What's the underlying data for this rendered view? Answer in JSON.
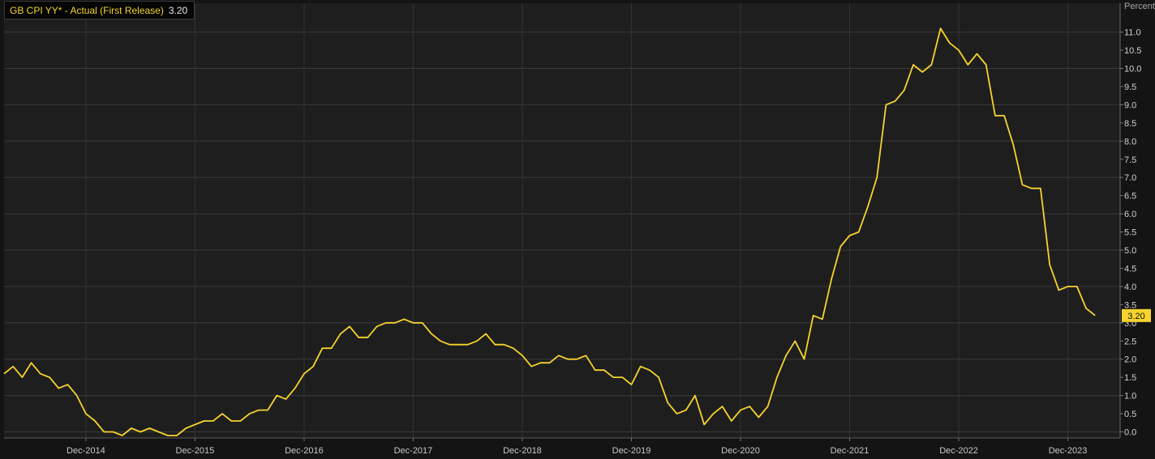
{
  "chart_data": {
    "type": "line",
    "title": "",
    "xlabel": "",
    "ylabel": "Percent",
    "legend": {
      "name": "GB CPI YY* - Actual (First Release)",
      "value": "3.20"
    },
    "last_value_label": "3.20",
    "ylim": [
      -0.1,
      11.3
    ],
    "y_ticks": [
      "0.0",
      "0.5",
      "1.0",
      "1.5",
      "2.0",
      "2.5",
      "3.0",
      "3.5",
      "4.0",
      "4.5",
      "5.0",
      "5.5",
      "6.0",
      "6.5",
      "7.0",
      "7.5",
      "8.0",
      "8.5",
      "9.0",
      "9.5",
      "10.0",
      "10.5",
      "11.0"
    ],
    "x_tick_labels": [
      "Dec-2014",
      "Dec-2015",
      "Dec-2016",
      "Dec-2017",
      "Dec-2018",
      "Dec-2019",
      "Dec-2020",
      "Dec-2021",
      "Dec-2022",
      "Dec-2023"
    ],
    "x_start": "Mar-2014",
    "grid": true,
    "legend_position": "top-left",
    "series": [
      {
        "name": "GB CPI YY* - Actual (First Release)",
        "color": "#f6d32d",
        "values": [
          1.6,
          1.8,
          1.5,
          1.9,
          1.6,
          1.5,
          1.2,
          1.3,
          1.0,
          0.5,
          0.3,
          0.0,
          0.0,
          -0.1,
          0.1,
          0.0,
          0.1,
          0.0,
          -0.1,
          -0.1,
          0.1,
          0.2,
          0.3,
          0.3,
          0.5,
          0.3,
          0.3,
          0.5,
          0.6,
          0.6,
          1.0,
          0.9,
          1.2,
          1.6,
          1.8,
          2.3,
          2.3,
          2.7,
          2.9,
          2.6,
          2.6,
          2.9,
          3.0,
          3.0,
          3.1,
          3.0,
          3.0,
          2.7,
          2.5,
          2.4,
          2.4,
          2.4,
          2.5,
          2.7,
          2.4,
          2.4,
          2.3,
          2.1,
          1.8,
          1.9,
          1.9,
          2.1,
          2.0,
          2.0,
          2.1,
          1.7,
          1.7,
          1.5,
          1.5,
          1.3,
          1.8,
          1.7,
          1.5,
          0.8,
          0.5,
          0.6,
          1.0,
          0.2,
          0.5,
          0.7,
          0.3,
          0.6,
          0.7,
          0.4,
          0.7,
          1.5,
          2.1,
          2.5,
          2.0,
          3.2,
          3.1,
          4.2,
          5.1,
          5.4,
          5.5,
          6.2,
          7.0,
          9.0,
          9.1,
          9.4,
          10.1,
          9.9,
          10.1,
          11.1,
          10.7,
          10.5,
          10.1,
          10.4,
          10.1,
          8.7,
          8.7,
          7.9,
          6.8,
          6.7,
          6.7,
          4.6,
          3.9,
          4.0,
          4.0,
          3.4,
          3.2
        ]
      }
    ]
  }
}
